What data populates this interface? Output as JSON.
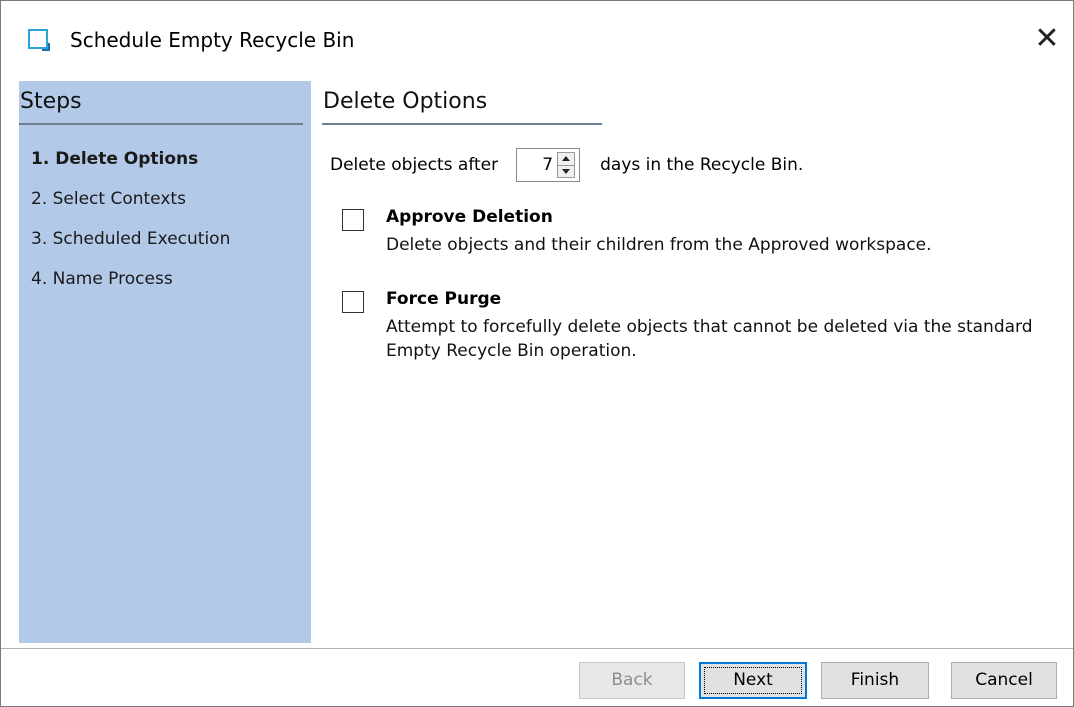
{
  "window": {
    "title": "Schedule Empty Recycle Bin",
    "close_label": "✕"
  },
  "steps": {
    "header": "Steps",
    "items": [
      {
        "label": "1. Delete Options",
        "active": true
      },
      {
        "label": "2. Select Contexts",
        "active": false
      },
      {
        "label": "3. Scheduled Execution",
        "active": false
      },
      {
        "label": "4. Name Process",
        "active": false
      }
    ]
  },
  "main": {
    "section_title": "Delete Options",
    "days": {
      "label_before": "Delete objects after",
      "value": "7",
      "label_after": "days in the Recycle Bin."
    },
    "options": [
      {
        "title": "Approve Deletion",
        "description": "Delete objects and their children from the Approved workspace.",
        "checked": false
      },
      {
        "title": "Force Purge",
        "description": "Attempt to forcefully delete objects that cannot be deleted via the standard Empty Recycle Bin operation.",
        "checked": false
      }
    ]
  },
  "footer": {
    "back_label": "Back",
    "next_label": "Next",
    "finish_label": "Finish",
    "cancel_label": "Cancel"
  },
  "colors": {
    "steps_panel_bg": "#b3c9e8",
    "default_button_border": "#0078d7",
    "title_icon": "#2aa3d8"
  },
  "icons": {
    "title_icon": "window-icon",
    "close_icon": "close-icon"
  }
}
